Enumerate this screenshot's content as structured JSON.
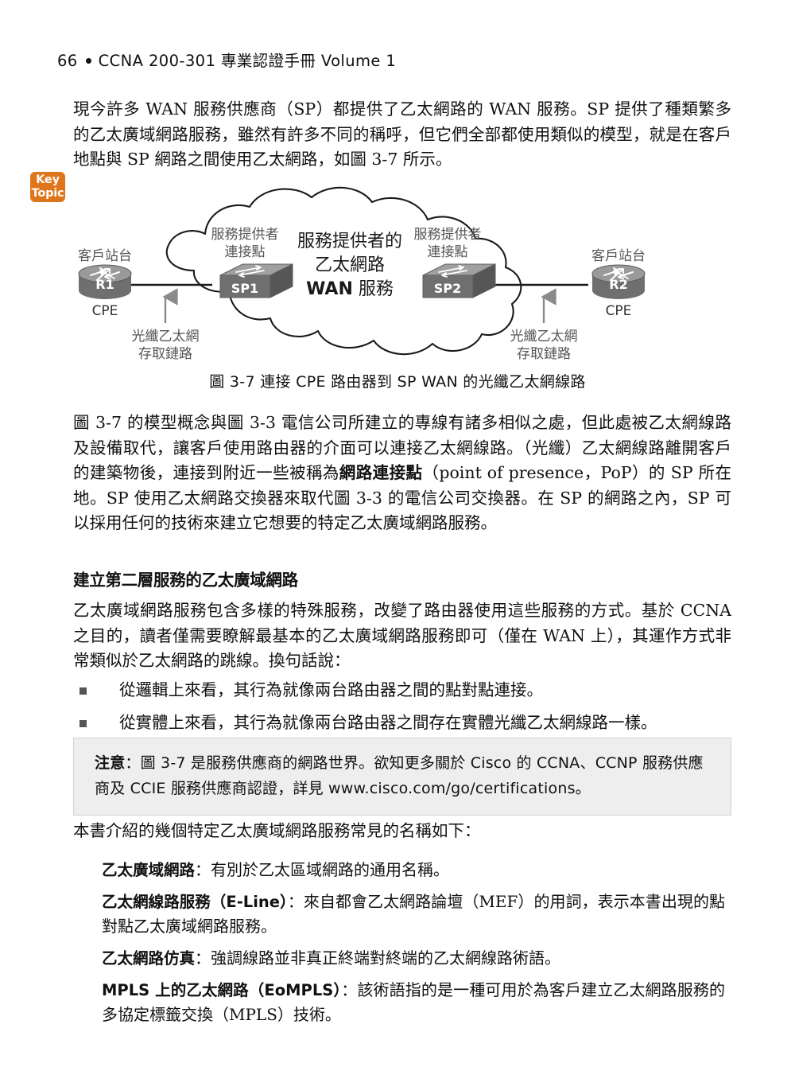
{
  "header": {
    "folio": "66",
    "book_title": "CCNA 200-301 專業認證手冊 Volume 1"
  },
  "key_topic": {
    "line1": "Key",
    "line2": "Topic",
    "color": "#e0761b"
  },
  "paragraphs": {
    "intro": "現今許多 WAN 服務供應商（SP）都提供了乙太網路的 WAN 服務。SP 提供了種類繁多的乙太廣域網路服務，雖然有許多不同的稱呼，但它們全部都使用類似的模型，就是在客戶地點與 SP 網路之間使用乙太網路，如圖 3-7 所示。",
    "after_figure_a": "圖 3-7 的模型概念與圖 3-3 電信公司所建立的專線有諸多相似之處，但此處被乙太網線路及設備取代，讓客戶使用路由器的介面可以連接乙太網線路。（光纖）乙太網線路離開客戶的建築物後，連接到附近一些被稱為",
    "after_figure_bold": "網路連接點",
    "after_figure_b": "（point of presence，PoP）的 SP 所在地。SP 使用乙太網路交換器來取代圖 3-3 的電信公司交換器。在 SP 的網路之內，SP 可以採用任何的技術來建立它想要的特定乙太廣域網路服務。",
    "section_body": "乙太廣域網路服務包含多樣的特殊服務，改變了路由器使用這些服務的方式。基於 CCNA 之目的，讀者僅需要瞭解最基本的乙太廣域網路服務即可（僅在 WAN 上），其運作方式非常類似於乙太網路的跳線。換句話說：",
    "names_intro": "本書介紹的幾個特定乙太廣域網路服務常見的名稱如下："
  },
  "section_heading": "建立第二層服務的乙太廣域網路",
  "bullets": [
    "從邏輯上來看，其行為就像兩台路由器之間的點對點連接。",
    "從實體上來看，其行為就像兩台路由器之間存在實體光纖乙太網線路一樣。"
  ],
  "note": {
    "label": "注意",
    "text": "：圖 3-7 是服務供應商的網路世界。欲知更多關於 Cisco 的 CCNA、CCNP 服務供應商及 CCIE 服務供應商認證，詳見 www.cisco.com/go/certifications。",
    "background": "#eeeeee"
  },
  "terms": [
    {
      "name": "乙太廣域網路",
      "desc": "：有別於乙太區域網路的通用名稱。"
    },
    {
      "name": "乙太網線路服務（E-Line）",
      "desc": "：來自都會乙太網路論壇（MEF）的用詞，表示本書出現的點對點乙太廣域網路服務。"
    },
    {
      "name": "乙太網路仿真",
      "desc": "：強調線路並非真正終端對終端的乙太網線路術語。"
    },
    {
      "name": "MPLS 上的乙太網路（EoMPLS）",
      "desc": "：該術語指的是一種可用於為客戶建立乙太網路服務的多協定標籤交換（MPLS）技術。"
    }
  ],
  "figure": {
    "caption": "圖 3-7  連接 CPE 路由器到 SP WAN 的光纖乙太網線路",
    "cloud_text": {
      "line1": "服務提供者的",
      "line2": "乙太網路",
      "line3_bold": "WAN",
      "line3_rest": " 服務"
    },
    "left_site": {
      "title": "客戶站台",
      "device_label": "R1",
      "sub_label": "CPE"
    },
    "right_site": {
      "title": "客戶站台",
      "device_label": "R2",
      "sub_label": "CPE"
    },
    "left_pop": {
      "line1": "服務提供者",
      "line2": "連接點",
      "device_label": "SP1"
    },
    "right_pop": {
      "line1": "服務提供者",
      "line2": "連接點",
      "device_label": "SP2"
    },
    "left_link": {
      "line1": "光纖乙太網",
      "line2": "存取鏈路"
    },
    "right_link": {
      "line1": "光纖乙太網",
      "line2": "存取鏈路"
    },
    "colors": {
      "device_fill": "#6f6f6f",
      "device_top": "#8b8b8b",
      "cloud_stroke": "#1a1a1a",
      "link_line": "#1a1a1a",
      "arrow": "#8a8a8a"
    }
  }
}
